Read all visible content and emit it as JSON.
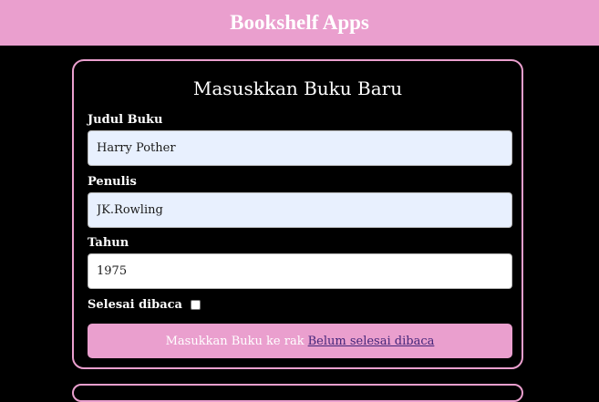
{
  "header": {
    "title": "Bookshelf Apps"
  },
  "form": {
    "title": "Masuskkan Buku Baru",
    "fields": [
      {
        "label": "Judul Buku",
        "value": "Harry Pother"
      },
      {
        "label": "Penulis",
        "value": "JK.Rowling"
      },
      {
        "label": "Tahun",
        "value": "1975"
      }
    ],
    "complete": {
      "label": "Selesai dibaca",
      "checked": false
    },
    "submit": {
      "prefix": "Masukkan Buku ke rak",
      "shelf": "Belum selesai dibaca"
    }
  },
  "colors": {
    "accent": "#ea9fce",
    "background": "#000000",
    "autofill": "#e8f0fe",
    "shelf_link": "#44257a"
  }
}
